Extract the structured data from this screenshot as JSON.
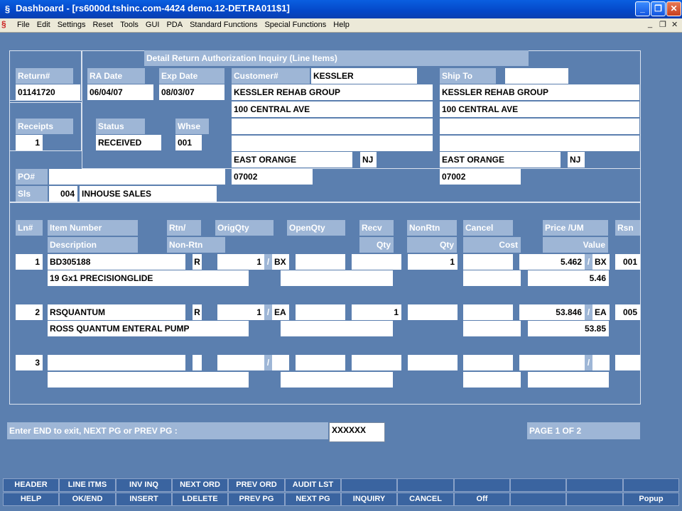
{
  "window": {
    "title": "Dashboard - [rs6000d.tshinc.com-4424 demo.12-DET.RA011$1]",
    "app_icon": "app-logo-icon",
    "buttons": [
      "minimize-icon",
      "restore-icon",
      "close-icon"
    ]
  },
  "menu": [
    "File",
    "Edit",
    "Settings",
    "Reset",
    "Tools",
    "GUI",
    "PDA",
    "Standard Functions",
    "Special Functions",
    "Help"
  ],
  "screen_title": "Detail Return Authorization Inquiry (Line Items)",
  "header": {
    "return_label": "Return#",
    "return_value": "01141720",
    "ra_date_label": "RA Date",
    "ra_date_value": "06/04/07",
    "exp_date_label": "Exp Date",
    "exp_date_value": "08/03/07",
    "receipts_label": "Receipts",
    "receipts_value": "1",
    "status_label": "Status",
    "status_value": "RECEIVED",
    "whse_label": "Whse",
    "whse_value": "001",
    "po_label": "PO#",
    "po_value": "",
    "sls_label": "Sls",
    "sls_code": "004",
    "sls_name": "INHOUSE SALES"
  },
  "customer": {
    "label": "Customer#",
    "id": "KESSLER",
    "name": "KESSLER REHAB GROUP",
    "addr1": "100 CENTRAL AVE",
    "addr2": "",
    "addr3": "",
    "city": "EAST ORANGE",
    "state": "NJ",
    "zip": "07002"
  },
  "ship_to": {
    "label": "Ship To",
    "id": "",
    "name": "KESSLER REHAB GROUP",
    "addr1": "100 CENTRAL AVE",
    "addr2": "",
    "addr3": "",
    "city": "EAST ORANGE",
    "state": "NJ",
    "zip": "07002"
  },
  "columns": {
    "ln": "Ln#",
    "item_number": "Item Number",
    "description": "Description",
    "rtn": "Rtn/",
    "non_rtn": "Non-Rtn",
    "orig_qty": "OrigQty",
    "open_qty": "OpenQty",
    "recv": "Recv",
    "recv_qty": "Qty",
    "nonrtn": "NonRtn",
    "nonrtn_qty": "Qty",
    "cancel": "Cancel",
    "cost": "Cost",
    "price_um": "Price     /UM",
    "value": "Value",
    "rsn": "Rsn"
  },
  "lines": [
    {
      "ln": "1",
      "item": "BD305188",
      "desc": "19 Gx1 PRECISIONGLIDE",
      "rtn": "R",
      "orig_qty": "1",
      "sep": "/",
      "orig_um": "BX",
      "open_qty": "",
      "recv_qty": "",
      "nonrtn_qty": "1",
      "cancel": "",
      "cost": "",
      "price": "5.462",
      "price_um": "BX",
      "value": "5.46",
      "rsn": "001"
    },
    {
      "ln": "2",
      "item": "RSQUANTUM",
      "desc": "ROSS QUANTUM ENTERAL PUMP",
      "rtn": "R",
      "orig_qty": "1",
      "sep": "/",
      "orig_um": "EA",
      "open_qty": "",
      "recv_qty": "1",
      "nonrtn_qty": "",
      "cancel": "",
      "cost": "",
      "price": "53.846",
      "price_um": "EA",
      "value": "53.85",
      "rsn": "005"
    },
    {
      "ln": "3",
      "item": "",
      "desc": "",
      "rtn": "",
      "orig_qty": "",
      "sep": "/",
      "orig_um": "",
      "open_qty": "",
      "recv_qty": "",
      "nonrtn_qty": "",
      "cancel": "",
      "cost": "",
      "price": "",
      "price_um": "",
      "value": "",
      "rsn": ""
    }
  ],
  "prompt": {
    "text": "Enter END to exit, NEXT PG or PREV PG :",
    "value": "XXXXXX",
    "page": "PAGE  1 OF  2"
  },
  "fkeys_row1": [
    "HEADER",
    "LINE ITMS",
    "INV INQ",
    "NEXT ORD",
    "PREV ORD",
    "AUDIT LST",
    "",
    "",
    "",
    "",
    "",
    ""
  ],
  "fkeys_row2": [
    "HELP",
    "OK/END",
    "INSERT",
    "LDELETE",
    "PREV PG",
    "NEXT PG",
    "INQUIRY",
    "CANCEL",
    "Off",
    "",
    "",
    "Popup"
  ]
}
